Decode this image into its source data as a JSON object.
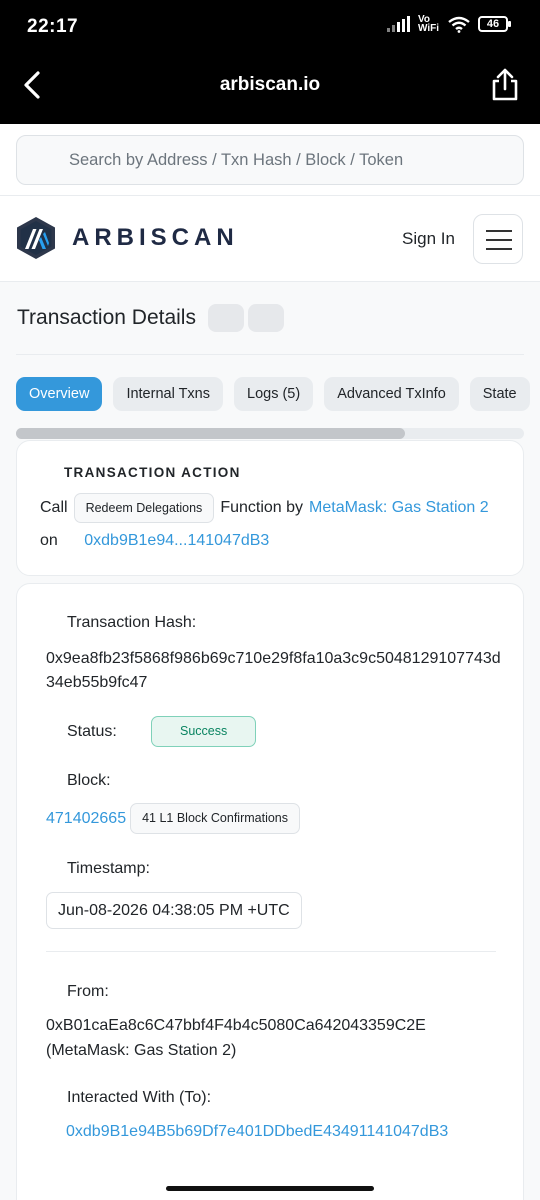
{
  "status_bar": {
    "time": "22:17",
    "network": "Vo WiFi",
    "battery": "46"
  },
  "browser": {
    "url": "arbiscan.io"
  },
  "search": {
    "placeholder": "Search by Address / Txn Hash / Block / Token"
  },
  "nav": {
    "brand": "ARBISCAN",
    "sign_in": "Sign In"
  },
  "page": {
    "title": "Transaction Details"
  },
  "tabs": [
    {
      "label": "Overview",
      "active": true
    },
    {
      "label": "Internal Txns"
    },
    {
      "label": "Logs (5)"
    },
    {
      "label": "Advanced TxInfo"
    },
    {
      "label": "State"
    }
  ],
  "action": {
    "heading": "TRANSACTION ACTION",
    "call": "Call",
    "function_name": "Redeem Delegations",
    "function_by": "Function by",
    "caller": "MetaMask: Gas Station 2",
    "on": "on",
    "target": "0xdb9B1e94...141047dB3"
  },
  "details": {
    "hash_label": "Transaction Hash:",
    "hash": "0x9ea8fb23f5868f986b69c710e29f8fa10a3c9c5048129107743d34eb55b9fc47",
    "status_label": "Status:",
    "status": "Success",
    "block_label": "Block:",
    "block": "471402665",
    "confirmations": "41 L1 Block Confirmations",
    "timestamp_label": "Timestamp:",
    "timestamp": "Jun-08-2026 04:38:05 PM +UTC",
    "from_label": "From:",
    "from_address": "0xB01caEa8c6C47bbf4F4b4c5080Ca642043359C2E",
    "from_name": "(MetaMask: Gas Station 2)",
    "to_label": "Interacted With (To):",
    "to_address": "0xdb9B1e94B5b69Df7e401DDbedE43491141047dB3"
  },
  "colors": {
    "accent": "#3498db",
    "success": "#0a8461",
    "header": "#000000"
  }
}
